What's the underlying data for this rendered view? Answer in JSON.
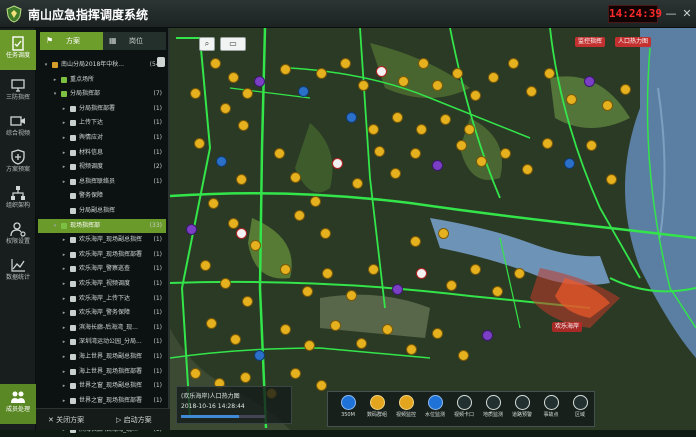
{
  "header": {
    "title": "南山应急指挥调度系统",
    "clock": "14:24:39",
    "minimize": "—",
    "close": "✕"
  },
  "rail": {
    "items": [
      {
        "label": "任务调度",
        "icon": "clipboard-icon"
      },
      {
        "label": "三防指挥",
        "icon": "monitor-icon"
      },
      {
        "label": "综合视频",
        "icon": "video-icon"
      },
      {
        "label": "方案预案",
        "icon": "shield-icon"
      },
      {
        "label": "组织架构",
        "icon": "org-chart-icon"
      },
      {
        "label": "权限设置",
        "icon": "user-settings-icon"
      },
      {
        "label": "数据统计",
        "icon": "line-chart-icon"
      }
    ],
    "bottom": {
      "label": "成员处理",
      "icon": "group-icon"
    }
  },
  "panel": {
    "tabs": [
      {
        "label": "方案",
        "icon": "flag-icon"
      },
      {
        "label": "岗位",
        "icon": "grid-icon"
      }
    ],
    "tree": [
      {
        "label": "南山分局2018年中秋...",
        "count": "(54)",
        "level": 0,
        "toggle": "v"
      },
      {
        "label": "重点场所",
        "count": "",
        "level": 1,
        "toggle": ">"
      },
      {
        "label": "分局指挥部",
        "count": "(7)",
        "level": 1,
        "toggle": "v"
      },
      {
        "label": "分局指挥部署",
        "count": "(1)",
        "level": 2,
        "toggle": ">"
      },
      {
        "label": "上传下达",
        "count": "(1)",
        "level": 2,
        "toggle": ">"
      },
      {
        "label": "舆情应对",
        "count": "(1)",
        "level": 2,
        "toggle": ">"
      },
      {
        "label": "材料信息",
        "count": "(1)",
        "level": 2,
        "toggle": ">"
      },
      {
        "label": "视频调度",
        "count": "(2)",
        "level": 2,
        "toggle": ">"
      },
      {
        "label": "总指挥联络员",
        "count": "(1)",
        "level": 2,
        "toggle": ">"
      },
      {
        "label": "警务保障",
        "count": "",
        "level": 2,
        "toggle": ""
      },
      {
        "label": "分局副总指挥",
        "count": "",
        "level": 2,
        "toggle": ""
      },
      {
        "label": "现场指挥部",
        "count": "(33)",
        "level": 1,
        "toggle": "v",
        "selected": true
      },
      {
        "label": "欢乐海岸_现场副总指挥",
        "count": "(1)",
        "level": 2,
        "toggle": ">"
      },
      {
        "label": "欢乐海岸_现场指挥部署",
        "count": "(1)",
        "level": 2,
        "toggle": ">"
      },
      {
        "label": "欢乐海岸_警察巡查",
        "count": "(1)",
        "level": 2,
        "toggle": ">"
      },
      {
        "label": "欢乐海岸_视频调度",
        "count": "(1)",
        "level": 2,
        "toggle": ">"
      },
      {
        "label": "欢乐海岸_上传下达",
        "count": "(1)",
        "level": 2,
        "toggle": ">"
      },
      {
        "label": "欢乐海岸_警务保障",
        "count": "(1)",
        "level": 2,
        "toggle": ">"
      },
      {
        "label": "滨海长廊-后海湾_现...",
        "count": "(1)",
        "level": 2,
        "toggle": ">"
      },
      {
        "label": "深圳湾运动公园_分局...",
        "count": "(1)",
        "level": 2,
        "toggle": ">"
      },
      {
        "label": "海上世界_现场副总指挥",
        "count": "(1)",
        "level": 2,
        "toggle": ">"
      },
      {
        "label": "海上世界_现场指挥部署",
        "count": "(1)",
        "level": 2,
        "toggle": ">"
      },
      {
        "label": "世界之窗_现场副总指挥",
        "count": "(1)",
        "level": 2,
        "toggle": ">"
      },
      {
        "label": "世界之窗_现场指挥部署",
        "count": "(1)",
        "level": 2,
        "toggle": ">"
      },
      {
        "label": "滨海长廊-后海湾_现...",
        "count": "(1)",
        "level": 2,
        "toggle": ">"
      },
      {
        "label": "滨海长廊-后海湾_现...",
        "count": "(1)",
        "level": 2,
        "toggle": ">"
      }
    ],
    "footer": {
      "close_label": "关闭方案",
      "start_label": "启动方案"
    }
  },
  "map": {
    "labels": [
      "监控指挥",
      "人口热力图",
      "欢乐海岸"
    ],
    "video": {
      "title": "(欢乐海岸)人口热力图",
      "stamp": "2018-10-16 14:28:44"
    },
    "toolbar": [
      {
        "label": "350M",
        "icon": "radio-icon"
      },
      {
        "label": "数码群组",
        "icon": "walkie-icon"
      },
      {
        "label": "视频监控",
        "icon": "camera-icon"
      },
      {
        "label": "水位监测",
        "icon": "water-level-icon"
      },
      {
        "label": "视频卡口",
        "icon": "checkpoint-icon"
      },
      {
        "label": "地质监测",
        "icon": "terrain-icon"
      },
      {
        "label": "道路预警",
        "icon": "road-warning-icon"
      },
      {
        "label": "事故点",
        "icon": "warning-icon"
      },
      {
        "label": "区域",
        "icon": "area-icon"
      }
    ]
  },
  "colors": {
    "accent": "#6b9a2a",
    "clock": "#ff2a2a",
    "road": "#39e64d",
    "pin": "#e6b11e"
  }
}
